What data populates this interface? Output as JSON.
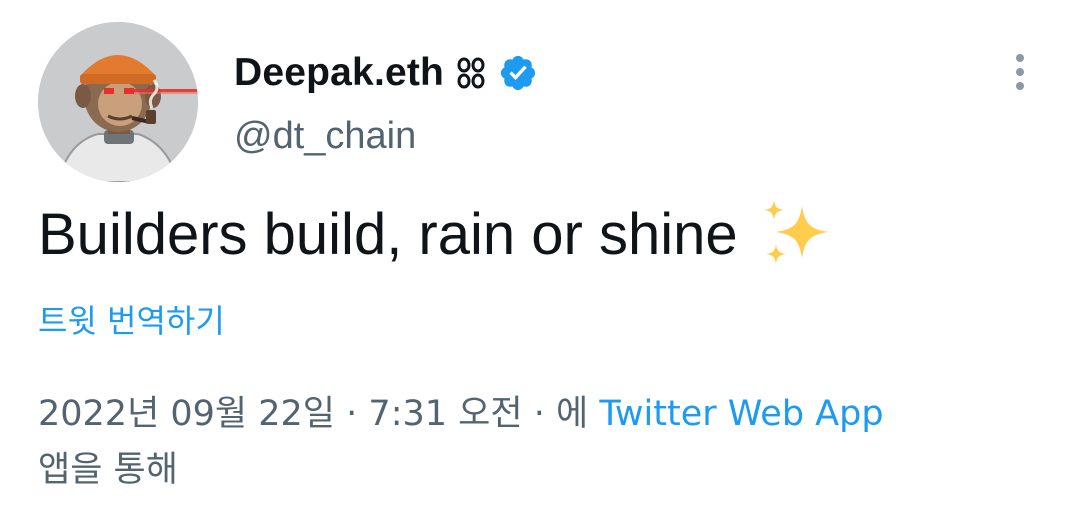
{
  "author": {
    "display_name": "Deepak.eth",
    "handle": "@dt_chain",
    "avatar_icon": "bored-ape-avatar",
    "name_emoji_icon": "chain-link-icon",
    "verified_icon": "verified-badge-icon",
    "verified_color": "#1d9bf0"
  },
  "tweet": {
    "text": "Builders build, rain or shine",
    "emoji_icon": "sparkles-icon"
  },
  "translate": {
    "label": "트윗 번역하기"
  },
  "meta": {
    "date": "2022년 09월 22일",
    "separator": "·",
    "time": "7:31 오전",
    "via_prefix": "에",
    "source": "Twitter Web App",
    "via_suffix": "앱을 통해"
  },
  "menu": {
    "icon": "more-options-icon"
  },
  "colors": {
    "accent": "#1d9bf0",
    "text_primary": "#0f1419",
    "text_secondary": "#536471"
  }
}
